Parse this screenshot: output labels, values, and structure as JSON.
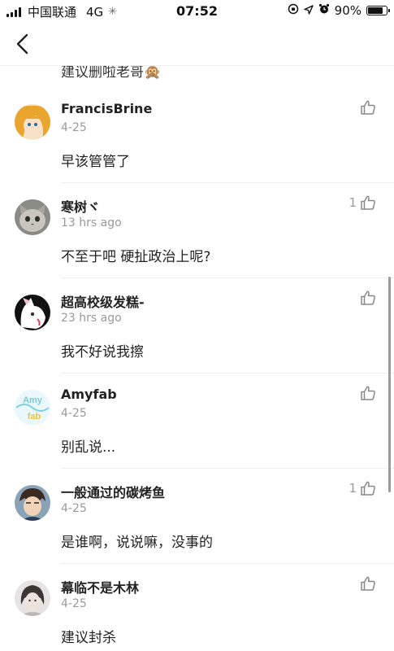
{
  "status_bar": {
    "carrier": "中国联通",
    "network": "4G",
    "time": "07:52",
    "battery": "90%",
    "battery_level": 0.9
  },
  "top_partial_comment": "建议删啦老哥🙊",
  "comments": [
    {
      "name": "FrancisBrine",
      "time": "4-25",
      "content": "早该管管了",
      "likes": ""
    },
    {
      "name": "寒树ヾ",
      "time": "13 hrs ago",
      "content": "不至于吧 硬扯政治上呢?",
      "likes": "1"
    },
    {
      "name": "超高校级发糕-",
      "time": "23 hrs ago",
      "content": "我不好说我擦",
      "likes": ""
    },
    {
      "name": "Amyfab",
      "time": "4-25",
      "content": "别乱说...",
      "likes": ""
    },
    {
      "name": "一般通过的碳烤鱼",
      "time": "4-25",
      "content": "是谁啊，说说嘛，没事的",
      "likes": "1"
    },
    {
      "name": "幕临不是木林",
      "time": "4-25",
      "content": "建议封杀",
      "likes": ""
    }
  ],
  "avatar_text": {
    "amy_line1": "Amy",
    "amy_line2": "fab"
  },
  "colors": {
    "text": "#222222",
    "muted": "#9a9a9a",
    "divider": "#eeeeee",
    "icon": "#888888"
  }
}
